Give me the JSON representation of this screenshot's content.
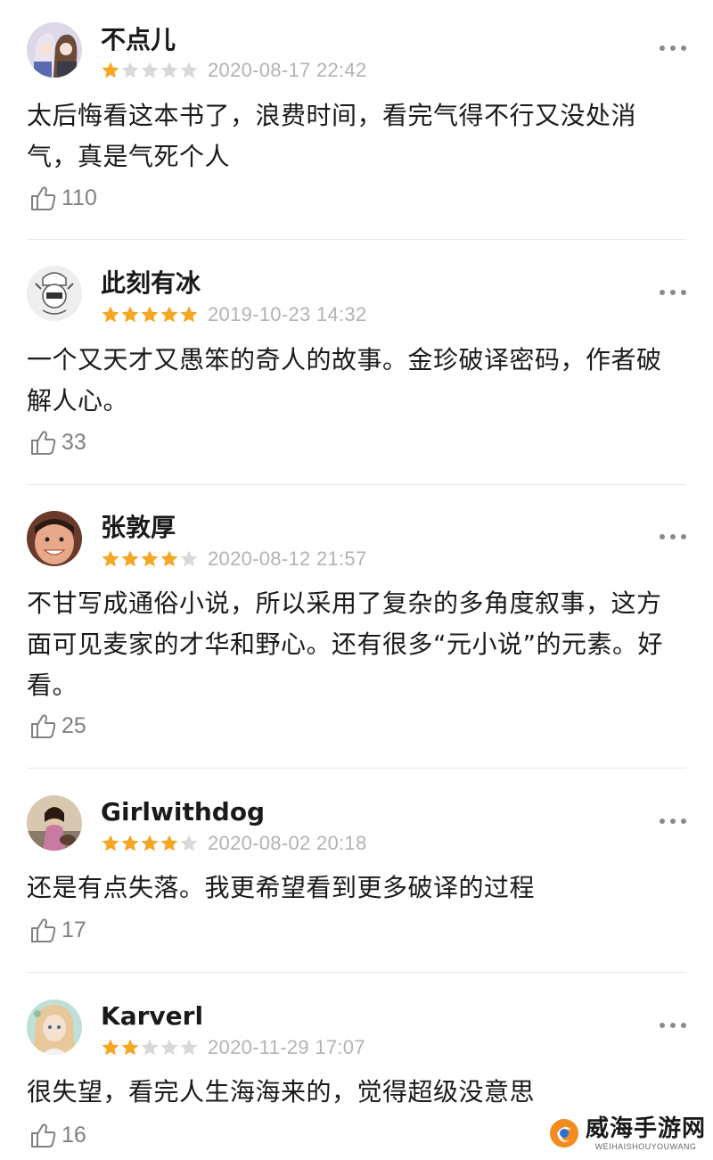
{
  "reviews": [
    {
      "username": "不点儿",
      "rating": 1,
      "date": "2020-08-17 22:42",
      "content": "太后悔看这本书了，浪费时间，看完气得不行又没处消气，真是气死个人",
      "likes": "110",
      "avatar": "anime-couple-avatar"
    },
    {
      "username": "此刻有冰",
      "rating": 5,
      "date": "2019-10-23 14:32",
      "content": "一个又天才又愚笨的奇人的故事。金珍破译密码，作者破解人心。",
      "likes": "33",
      "avatar": "meme-character-avatar"
    },
    {
      "username": "张敦厚",
      "rating": 4,
      "date": "2020-08-12 21:57",
      "content": "不甘写成通俗小说，所以采用了复杂的多角度叙事，这方面可见麦家的才华和野心。还有很多“元小说”的元素。好看。",
      "likes": "25",
      "avatar": "child-face-avatar"
    },
    {
      "username": "Girlwithdog",
      "rating": 4,
      "date": "2020-08-02 20:18",
      "content": "还是有点失落。我更希望看到更多破译的过程",
      "likes": "17",
      "avatar": "girl-photo-avatar"
    },
    {
      "username": "Karverl",
      "rating": 2,
      "date": "2020-11-29 17:07",
      "content": "很失望，看完人生海海来的，觉得超级没意思",
      "likes": "16",
      "avatar": "anime-girl-avatar"
    }
  ],
  "colors": {
    "star_filled": "#f5a623",
    "star_empty": "#d9d9d9",
    "date": "#b3b3b3",
    "likes": "#808080",
    "divider": "#e8e8e8"
  },
  "icons": {
    "like": "thumbs-up-icon",
    "more": "more-dots-icon",
    "star": "star-icon"
  },
  "watermark": {
    "title": "威海手游网",
    "subtitle": "WEIHAISHOUYOUWANG"
  }
}
